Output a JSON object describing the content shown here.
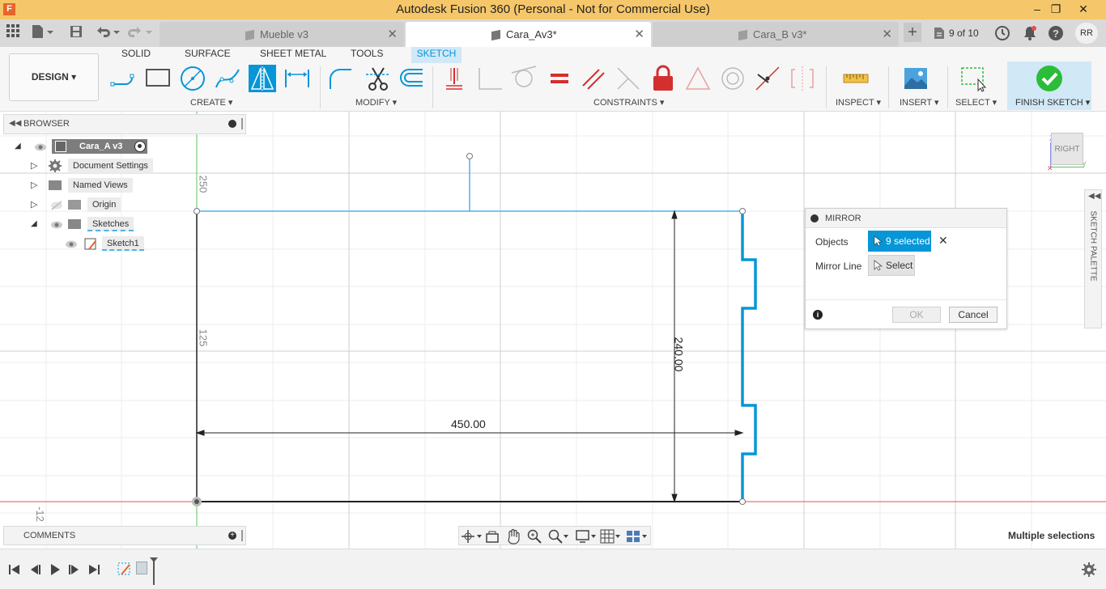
{
  "app": {
    "title": "Autodesk Fusion 360 (Personal - Not for Commercial Use)",
    "logo_letter": "F"
  },
  "tabs": [
    {
      "label": "Mueble v3",
      "active": false
    },
    {
      "label": "Cara_Av3*",
      "active": true
    },
    {
      "label": "Cara_B v3*",
      "active": false
    }
  ],
  "version_badge": "9 of 10",
  "user_initials": "RR",
  "workspace": {
    "label": "DESIGN"
  },
  "ribbon_tabs": [
    "SOLID",
    "SURFACE",
    "SHEET METAL",
    "TOOLS",
    "SKETCH"
  ],
  "groups": {
    "create": "CREATE",
    "modify": "MODIFY",
    "constraints": "CONSTRAINTS",
    "inspect": "INSPECT",
    "insert": "INSERT",
    "select": "SELECT",
    "finish": "FINISH SKETCH"
  },
  "browser": {
    "title": "BROWSER",
    "root": "Cara_A v3",
    "items": [
      "Document Settings",
      "Named Views",
      "Origin",
      "Sketches"
    ],
    "sketch": "Sketch1"
  },
  "comments": {
    "title": "COMMENTS"
  },
  "mirror": {
    "title": "MIRROR",
    "objects_label": "Objects",
    "objects_value": "9 selected",
    "mirror_line_label": "Mirror Line",
    "mirror_line_value": "Select",
    "ok": "OK",
    "cancel": "Cancel"
  },
  "sketch_palette": "SKETCH PALETTE",
  "viewcube": {
    "face": "RIGHT",
    "axis_z": "Z",
    "axis_y": "Y"
  },
  "dimensions": {
    "width": "450.00",
    "height": "240.00"
  },
  "ruler": {
    "top": "250",
    "mid": "125",
    "bottom": "-12"
  },
  "status": "Multiple selections",
  "colors": {
    "accent": "#0696d7",
    "titlebar": "#f5c76a",
    "sketch_line": "#0696d7",
    "finish_check": "#2bbd3a",
    "axis_red": "#e05050",
    "axis_green": "#5bc45b"
  }
}
